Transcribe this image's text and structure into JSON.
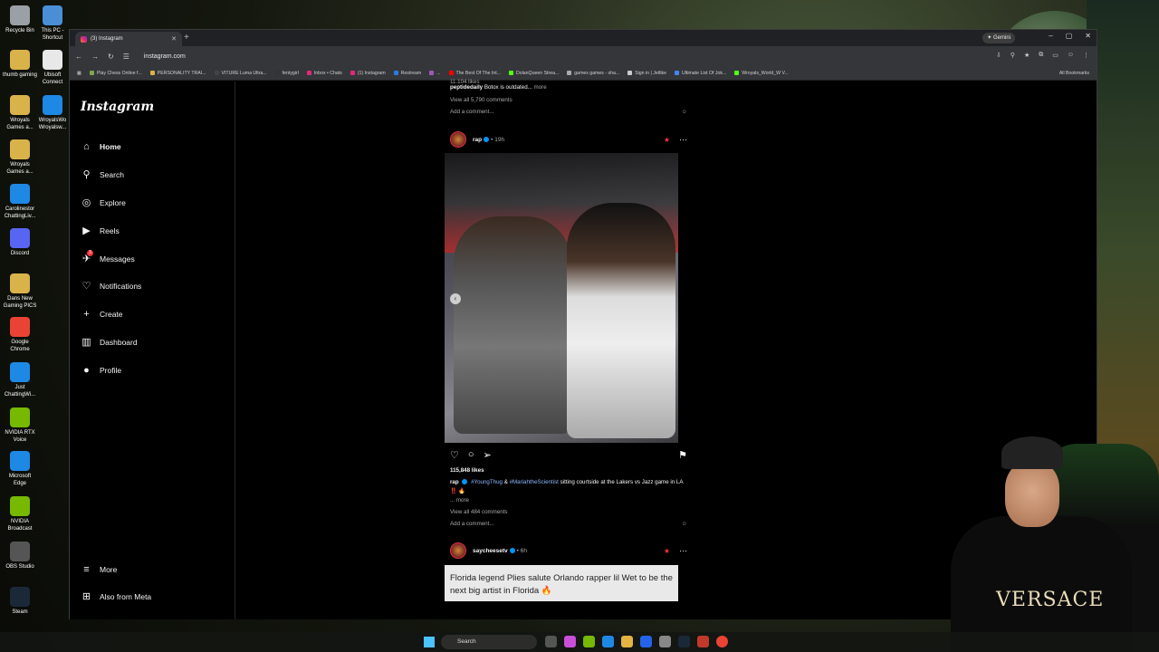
{
  "desktop": {
    "icons": [
      {
        "label": "Recycle Bin",
        "color": "#9aa0a6"
      },
      {
        "label": "This PC - Shortcut",
        "color": "#4a8fd6"
      },
      {
        "label": "thumb gaming",
        "color": "#d9b34a"
      },
      {
        "label": "Ubisoft Connect",
        "color": "#e8e8e8"
      },
      {
        "label": "Wroyals Games a...",
        "color": "#d9b34a"
      },
      {
        "label": "WroyalsWo Wroyalsw...",
        "color": "#1e88e5"
      },
      {
        "label": "Wroyals Games a...",
        "color": "#d9b34a"
      },
      {
        "label": "Carolinestor ChattingLiv...",
        "color": "#1e88e5"
      },
      {
        "label": "Discord",
        "color": "#5865f2"
      },
      {
        "label": "Dans New Gaming PICS",
        "color": "#d9b34a"
      },
      {
        "label": "Google Chrome",
        "color": "#ea4335"
      },
      {
        "label": "Just ChattingWi...",
        "color": "#1e88e5"
      },
      {
        "label": "NVIDIA RTX Voice",
        "color": "#76b900"
      },
      {
        "label": "Microsoft Edge",
        "color": "#1e88e5"
      },
      {
        "label": "NVIDIA Broadcast",
        "color": "#76b900"
      },
      {
        "label": "OBS Studio",
        "color": "#555555"
      },
      {
        "label": "Steam",
        "color": "#1b2838"
      }
    ]
  },
  "browser": {
    "tab_title": "(3) Instagram",
    "new_tab": "+",
    "gemini_label": "✦ Gemini",
    "url": "instagram.com",
    "window_controls": [
      "–",
      "▢",
      "✕"
    ],
    "bookmarks": [
      {
        "label": "Play Chess Online f...",
        "color": "#7fa650"
      },
      {
        "label": "PERSONALITY TRAI...",
        "color": "#d9b34a"
      },
      {
        "label": "VITURE Luma Ultra...",
        "color": "#444444"
      },
      {
        "label": "fentygirl",
        "color": "#333333"
      },
      {
        "label": "Inbox • Chats",
        "color": "#dd2a7b"
      },
      {
        "label": "(1) Instagram",
        "color": "#dd2a7b"
      },
      {
        "label": "Restream",
        "color": "#2a7bde"
      },
      {
        "label": "...",
        "color": "#9b59b6"
      },
      {
        "label": "The Best Of The Int...",
        "color": "#ff0000"
      },
      {
        "label": "DolanQueen Strea...",
        "color": "#53fc18"
      },
      {
        "label": "games games - sha...",
        "color": "#aaaaaa"
      },
      {
        "label": "Sign in | Jetlike",
        "color": "#cccccc"
      },
      {
        "label": "Ultimate List Of Jok...",
        "color": "#4285f4"
      },
      {
        "label": "Wroyals_World_W V...",
        "color": "#53fc18"
      }
    ],
    "all_bookmarks": "All Bookmarks"
  },
  "instagram": {
    "logo": "Instagram",
    "nav": [
      {
        "label": "Home",
        "icon": "⌂"
      },
      {
        "label": "Search",
        "icon": "⚲"
      },
      {
        "label": "Explore",
        "icon": "◎"
      },
      {
        "label": "Reels",
        "icon": "▶"
      },
      {
        "label": "Messages",
        "icon": "✈"
      },
      {
        "label": "Notifications",
        "icon": "♡"
      },
      {
        "label": "Create",
        "icon": "+"
      },
      {
        "label": "Dashboard",
        "icon": "▥"
      },
      {
        "label": "Profile",
        "icon": "●"
      }
    ],
    "messages_badge": "3",
    "nav_bottom": [
      {
        "label": "More",
        "icon": "≡"
      },
      {
        "label": "Also from Meta",
        "icon": "⊞"
      }
    ],
    "prev_post": {
      "likes": "11,104 likes",
      "caption_user": "peptidedaily",
      "caption_text": " Botox is outdated...",
      "more": " more",
      "comments": "View all 5,790 comments",
      "add_comment": "Add a comment..."
    },
    "post": {
      "username": "rap",
      "time": "19h",
      "likes": "115,848 likes",
      "caption_user": "rap",
      "tag1": "#YoungThug",
      "amp": " & ",
      "tag2": "#MariahtheScientist",
      "caption_text": " sitting courtside at the Lakers vs Jazz game in LA ‼️ 🔥",
      "more": "... more",
      "comments": "View all 484 comments",
      "add_comment": "Add a comment..."
    },
    "next_post": {
      "username": "saycheesetv",
      "time": "6h",
      "text": "Florida legend Plies salute Orlando rapper lil Wet to be the next big artist in Florida 🔥"
    }
  },
  "webcam": {
    "shirt_text": "VERSACE"
  },
  "taskbar": {
    "search": "Search"
  }
}
